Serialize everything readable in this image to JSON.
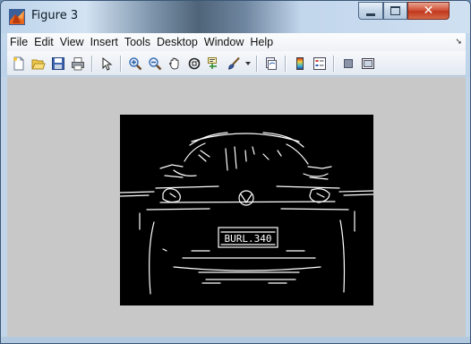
{
  "window": {
    "title": "Figure 3"
  },
  "menubar": {
    "items": [
      "File",
      "Edit",
      "View",
      "Insert",
      "Tools",
      "Desktop",
      "Window",
      "Help"
    ],
    "overflow_icon": "menu-overflow-arrow-icon"
  },
  "toolbar": {
    "buttons": [
      "new-figure-icon",
      "open-file-icon",
      "save-icon",
      "print-icon",
      "edit-plot-arrow-icon",
      "zoom-in-icon",
      "zoom-out-icon",
      "pan-hand-icon",
      "rotate-3d-icon",
      "data-cursor-icon",
      "brush-icon",
      "brush-dropdown-icon",
      "link-plot-icon",
      "colorbar-icon",
      "legend-icon",
      "hide-plot-tools-icon",
      "show-plot-tools-icon"
    ]
  },
  "figure": {
    "content": "binary-edge-map-image",
    "plate_text": "BURL.340"
  },
  "colors": {
    "canvas_bg": "#c8c8c8",
    "image_bg": "#000000",
    "edges": "#ffffff",
    "close_button": "#c1381d"
  }
}
